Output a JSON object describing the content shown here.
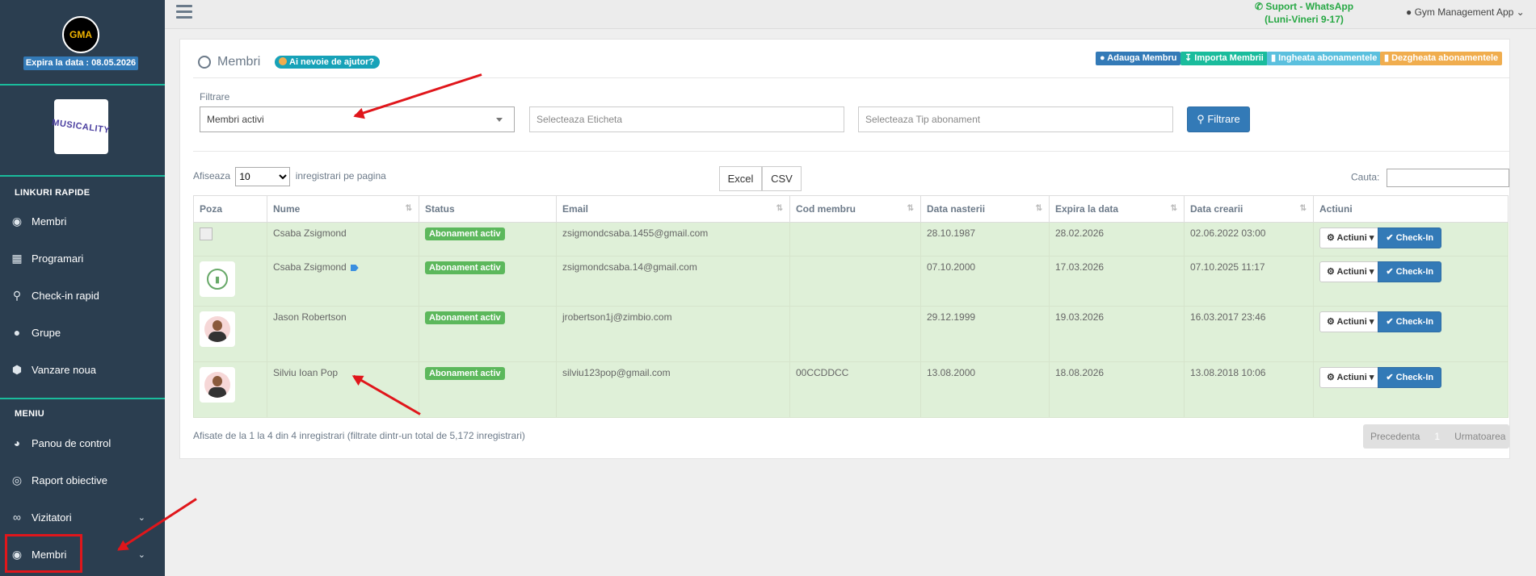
{
  "sidebar": {
    "logo": "GMA",
    "expire": "Expira la data : 08.05.2026",
    "gym_logo": "MUSICALITY",
    "quick_title": "LINKURI RAPIDE",
    "quick_items": [
      {
        "label": "Membri",
        "icon": "user-circle-icon"
      },
      {
        "label": "Programari",
        "icon": "calendar-icon"
      },
      {
        "label": "Check-in rapid",
        "icon": "map-pin-icon"
      },
      {
        "label": "Grupe",
        "icon": "users-icon"
      },
      {
        "label": "Vanzare noua",
        "icon": "cube-icon"
      }
    ],
    "menu_title": "MENIU",
    "menu_items": [
      {
        "label": "Panou de control",
        "icon": "dashboard-icon"
      },
      {
        "label": "Raport obiective",
        "icon": "target-icon"
      },
      {
        "label": "Vizitatori",
        "icon": "binoculars-icon"
      },
      {
        "label": "Membri",
        "icon": "user-circle-icon"
      }
    ]
  },
  "topbar": {
    "support_line1": "Suport - WhatsApp",
    "support_line2": "(Luni-Vineri 9-17)",
    "app_menu": "Gym Management App"
  },
  "panel": {
    "title": "Membri",
    "help": "Ai nevoie de ajutor?",
    "actions": [
      {
        "label": "Adauga Membru",
        "color": "#337ab7"
      },
      {
        "label": "Importa Membrii",
        "color": "#1abc9c"
      },
      {
        "label": "Ingheata abonamentele",
        "color": "#5bc0de"
      },
      {
        "label": "Dezgheata abonamentele",
        "color": "#f0ad4e"
      }
    ],
    "filter_label": "Filtrare",
    "filter_status": "Membri activi",
    "filter_tag_placeholder": "Selecteaza Eticheta",
    "filter_type_placeholder": "Selecteaza Tip abonament",
    "filter_button": "Filtrare",
    "show_prefix": "Afiseaza",
    "page_size": "10",
    "show_suffix": "inregistrari pe pagina",
    "excel": "Excel",
    "csv": "CSV",
    "search_label": "Cauta:",
    "columns": [
      "Poza",
      "Nume",
      "Status",
      "Email",
      "Cod membru",
      "Data nasterii",
      "Expira la data",
      "Data crearii",
      "Actiuni"
    ],
    "rows": [
      {
        "name": "Csaba Zsigmond",
        "status": "Abonament activ",
        "email": "zsigmondcsaba.1455@gmail.com",
        "code": "",
        "birth": "28.10.1987",
        "expires": "28.02.2026",
        "created": "02.06.2022 03:00"
      },
      {
        "name": "Csaba Zsigmond",
        "status": "Abonament activ",
        "email": "zsigmondcsaba.14@gmail.com",
        "code": "",
        "birth": "07.10.2000",
        "expires": "17.03.2026",
        "created": "07.10.2025 11:17"
      },
      {
        "name": "Jason Robertson",
        "status": "Abonament activ",
        "email": "jrobertson1j@zimbio.com",
        "code": "",
        "birth": "29.12.1999",
        "expires": "19.03.2026",
        "created": "16.03.2017 23:46"
      },
      {
        "name": "Silviu Ioan Pop",
        "status": "Abonament activ",
        "email": "silviu123pop@gmail.com",
        "code": "00CCDDCC",
        "birth": "13.08.2000",
        "expires": "18.08.2026",
        "created": "13.08.2018 10:06"
      }
    ],
    "actions_btn": "Actiuni",
    "checkin_btn": "Check-In",
    "showing": "Afisate de la 1 la 4 din 4 inregistrari (filtrate dintr-un total de 5,172 inregistrari)",
    "pager_prev": "Precedenta",
    "pager_page": "1",
    "pager_next": "Urmatoarea"
  }
}
